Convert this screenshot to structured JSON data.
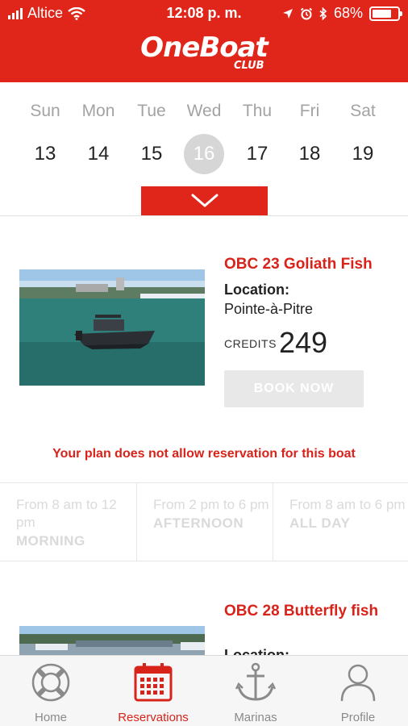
{
  "status": {
    "carrier": "Altice",
    "time": "12:08 p. m.",
    "battery": "68%"
  },
  "header": {
    "brand": "OneBoat",
    "sub": "CLUB"
  },
  "calendar": {
    "days": [
      {
        "name": "Sun",
        "num": "13"
      },
      {
        "name": "Mon",
        "num": "14"
      },
      {
        "name": "Tue",
        "num": "15"
      },
      {
        "name": "Wed",
        "num": "16",
        "selected": true
      },
      {
        "name": "Thu",
        "num": "17"
      },
      {
        "name": "Fri",
        "num": "18"
      },
      {
        "name": "Sat",
        "num": "19"
      }
    ]
  },
  "boats": [
    {
      "name": "OBC 23 Goliath Fish",
      "location_label": "Location:",
      "location": "Pointe-à-Pitre",
      "credits_label": "CREDITS",
      "credits": "249",
      "book_label": "BOOK NOW",
      "warning": "Your plan does not allow reservation for this boat",
      "slots": [
        {
          "time": "From 8 am to 12 pm",
          "name": "MORNING"
        },
        {
          "time": "From 2 pm to 6 pm",
          "name": "AFTERNOON"
        },
        {
          "time": "From 8 am to 6 pm",
          "name": "ALL DAY"
        }
      ]
    },
    {
      "name": "OBC 28 Butterfly fish",
      "location_label": "Location:"
    }
  ],
  "tabs": [
    {
      "label": "Home",
      "icon": "lifebuoy-icon"
    },
    {
      "label": "Reservations",
      "icon": "calendar-icon",
      "active": true
    },
    {
      "label": "Marinas",
      "icon": "anchor-icon"
    },
    {
      "label": "Profile",
      "icon": "person-icon"
    }
  ],
  "colors": {
    "brand_red": "#e0261b",
    "disabled_gray": "#e8e8e8",
    "tab_inactive": "#8a8a8a"
  }
}
